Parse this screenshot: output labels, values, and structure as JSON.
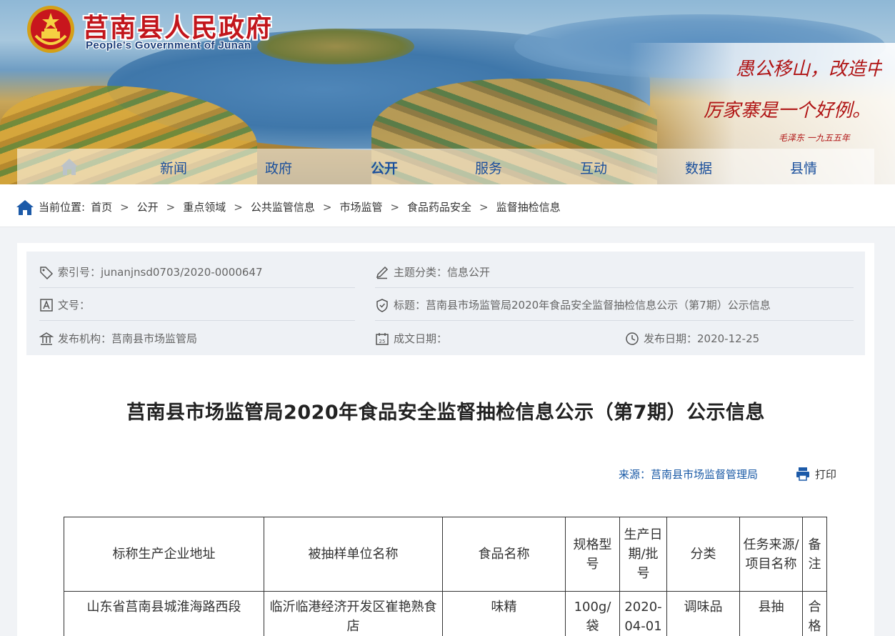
{
  "header": {
    "site_title": "莒南县人民政府",
    "site_subtitle": "People’s Government of Junan",
    "calligraphy_line1": "愚公移山，改造中国。",
    "calligraphy_line2": "厉家寨是一个好例。",
    "calligraphy_signature": "毛泽东 一九五五年"
  },
  "nav": {
    "items": [
      {
        "label": "新闻"
      },
      {
        "label": "政府"
      },
      {
        "label": "公开",
        "active": true
      },
      {
        "label": "服务"
      },
      {
        "label": "互动"
      },
      {
        "label": "数据"
      },
      {
        "label": "县情"
      }
    ]
  },
  "breadcrumb": {
    "prefix": "当前位置:",
    "items": [
      "首页",
      "公开",
      "重点领域",
      "公共监管信息",
      "市场监管",
      "食品药品安全",
      "监督抽检信息"
    ],
    "separator": ">"
  },
  "meta": {
    "index_no": "索引号：junanjnsd0703/2020-0000647",
    "topic": "主题分类：信息公开",
    "doc_no": "文号：",
    "title": "标题：莒南县市场监管局2020年食品安全监督抽检信息公示（第7期）公示信息",
    "publisher": "发布机构：莒南县市场监管局",
    "written_date": "成文日期：",
    "publish_date": "发布日期：2020-12-25"
  },
  "article": {
    "title": "莒南县市场监管局2020年食品安全监督抽检信息公示（第7期）公示信息",
    "source": "来源：莒南县市场监督管理局",
    "print_label": "打印"
  },
  "table": {
    "headers": [
      "标称生产企业地址",
      "被抽样单位名称",
      "食品名称",
      "规格型号",
      "生产日期/批号",
      "分类",
      "任务来源/项目名称",
      "备注"
    ],
    "rows": [
      [
        "山东省莒南县城淮海路西段",
        "临沂临港经济开发区崔艳熟食店",
        "味精",
        "100g/袋",
        "2020-04-01",
        "调味品",
        "县抽",
        "合格"
      ]
    ]
  },
  "colors": {
    "brand_red": "#c2161c",
    "nav_blue": "#1a4f9c",
    "link_blue": "#1a5aa6",
    "meta_bg": "#eef1f5"
  },
  "icons": {
    "home": "home-icon",
    "index": "tag-icon",
    "topic": "edit-icon",
    "doc_no": "doc-number-icon",
    "title": "shield-check-icon",
    "publisher": "building-icon",
    "written_date": "calendar-icon",
    "publish_date": "clock-icon",
    "print": "printer-icon"
  }
}
